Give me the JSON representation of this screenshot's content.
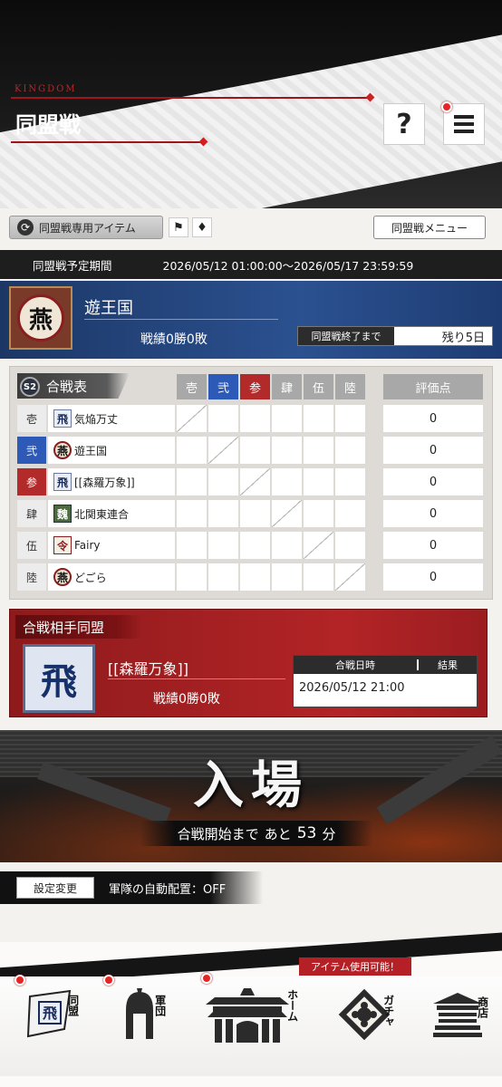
{
  "header": {
    "kingdom": "KINGDOM",
    "title": "同盟戦",
    "help": "?"
  },
  "toolbar": {
    "items_label": "同盟戦専用アイテム",
    "menu_label": "同盟戦メニュー"
  },
  "period": {
    "label": "同盟戦予定期間",
    "value": "2026/05/12 01:00:00～2026/05/17 23:59:59"
  },
  "alliance": {
    "emblem": "燕",
    "name": "遊王国",
    "record": "戦績0勝0敗",
    "ends_label": "同盟戦終了まで",
    "remaining": "残り5日"
  },
  "battle_table": {
    "season": "S2",
    "title": "合戦表",
    "columns": [
      "壱",
      "弐",
      "参",
      "肆",
      "伍",
      "陸"
    ],
    "score_header": "評価点",
    "rows": [
      {
        "label": "壱",
        "icon": "飛",
        "name": "気焔万丈",
        "score": "0"
      },
      {
        "label": "弐",
        "icon": "燕",
        "name": "遊王国",
        "score": "0"
      },
      {
        "label": "参",
        "icon": "飛",
        "name": "[[森羅万象]]",
        "score": "0"
      },
      {
        "label": "肆",
        "icon": "魏",
        "name": "北関東連合",
        "score": "0"
      },
      {
        "label": "伍",
        "icon": "令",
        "name": "Fairy",
        "score": "0"
      },
      {
        "label": "陸",
        "icon": "燕",
        "name": "どごら",
        "score": "0"
      }
    ]
  },
  "opponent": {
    "title": "合戦相手同盟",
    "emblem": "飛",
    "name": "[[森羅万象]]",
    "record": "戦績0勝0敗",
    "date_header": "合戦日時",
    "result_header": "結果",
    "date": "2026/05/12 21:00",
    "result": ""
  },
  "entry": {
    "title": "入場",
    "prefix": "合戦開始まで",
    "middle": "あと",
    "minutes": "53",
    "unit": "分"
  },
  "settings": {
    "button": "設定変更",
    "auto_deploy": "軍隊の自動配置：OFF"
  },
  "nav": {
    "notice": "アイテム使用可能！",
    "items": [
      {
        "label": "同盟"
      },
      {
        "label": "軍団"
      },
      {
        "label": "ホーム"
      },
      {
        "label": "ガチャ"
      },
      {
        "label": "商店"
      }
    ]
  },
  "colors": {
    "accent_red": "#b32a2a",
    "accent_blue": "#2d59b7",
    "header_black": "#0b0b0b"
  }
}
